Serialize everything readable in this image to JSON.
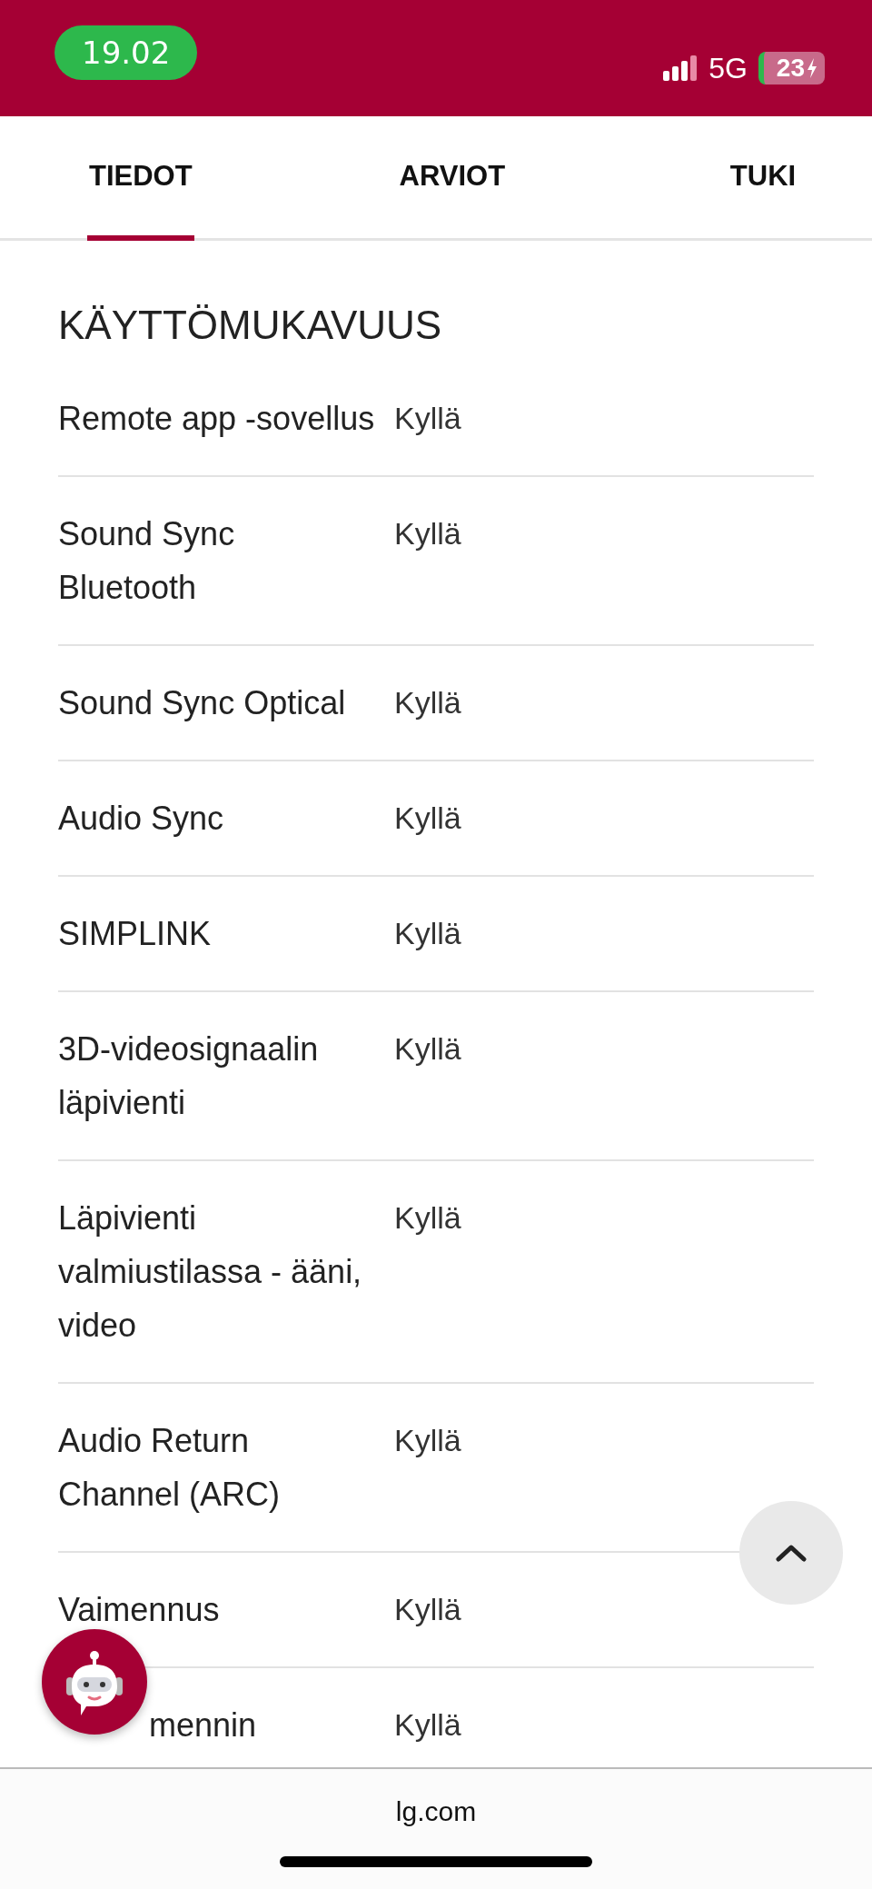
{
  "status_bar": {
    "time": "19.02",
    "network": "5G",
    "battery": "23"
  },
  "tabs": [
    {
      "label": "TIEDOT",
      "selected": true
    },
    {
      "label": "ARVIOT",
      "selected": false
    },
    {
      "label": "TUKI",
      "selected": false
    }
  ],
  "section": {
    "title": "KÄYTTÖMUKAVUUS",
    "rows": [
      {
        "label": "Remote app -sovellus",
        "value": "Kyllä"
      },
      {
        "label": "Sound Sync Bluetooth",
        "value": "Kyllä"
      },
      {
        "label": "Sound Sync Optical",
        "value": "Kyllä"
      },
      {
        "label": "Audio Sync",
        "value": "Kyllä"
      },
      {
        "label": "SIMPLINK",
        "value": "Kyllä"
      },
      {
        "label": "3D-videosignaalin läpivienti",
        "value": "Kyllä"
      },
      {
        "label": "Läpivienti valmiustilassa - ääni, video",
        "value": "Kyllä"
      },
      {
        "label": "Audio Return Channel (ARC)",
        "value": "Kyllä"
      },
      {
        "label": "Vaimennus",
        "value": "Kyllä"
      },
      {
        "label": "mennin",
        "value": "Kyllä",
        "covered": true
      }
    ]
  },
  "footer": {
    "url": "lg.com"
  }
}
